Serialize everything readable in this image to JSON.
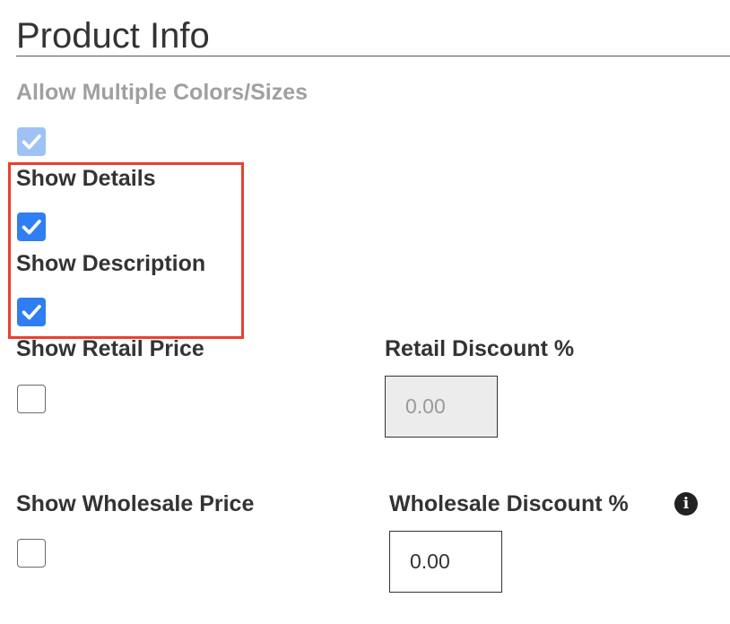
{
  "section": {
    "title": "Product Info"
  },
  "fields": {
    "allow_multiple": {
      "label": "Allow Multiple Colors/Sizes",
      "checked": true,
      "disabled": true
    },
    "show_details": {
      "label": "Show Details",
      "checked": true
    },
    "show_description": {
      "label": "Show Description",
      "checked": true
    },
    "show_retail_price": {
      "label": "Show Retail Price",
      "checked": false
    },
    "retail_discount": {
      "label": "Retail Discount %",
      "value": "0.00",
      "disabled": true
    },
    "show_wholesale_price": {
      "label": "Show Wholesale Price",
      "checked": false
    },
    "wholesale_discount": {
      "label": "Wholesale Discount %",
      "value": "0.00",
      "info_icon": "info-circle-icon",
      "info_glyph": "i"
    }
  },
  "colors": {
    "checkbox_checked": "#2f7ef3",
    "checkbox_disabled": "#9ec2f6",
    "highlight": "#e8412f",
    "text": "#333333",
    "disabled_text": "#a0a0a0"
  }
}
